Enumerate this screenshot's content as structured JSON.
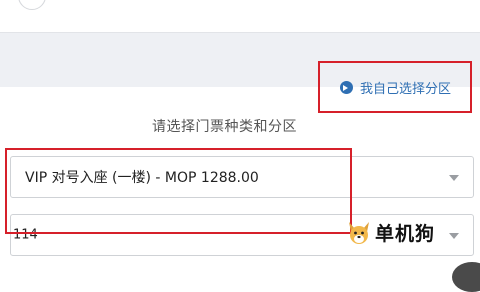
{
  "header": {
    "self_select_label": "我自己选择分区"
  },
  "form": {
    "section_title": "请选择门票种类和分区",
    "ticket_type": {
      "value": "VIP 对号入座 (一楼) - MOP 1288.00"
    },
    "zone": {
      "value": "114"
    }
  },
  "watermark": {
    "text": "单机狗"
  },
  "colors": {
    "highlight": "#d6202a",
    "link": "#2f6fb3",
    "band": "#eef0f4"
  }
}
